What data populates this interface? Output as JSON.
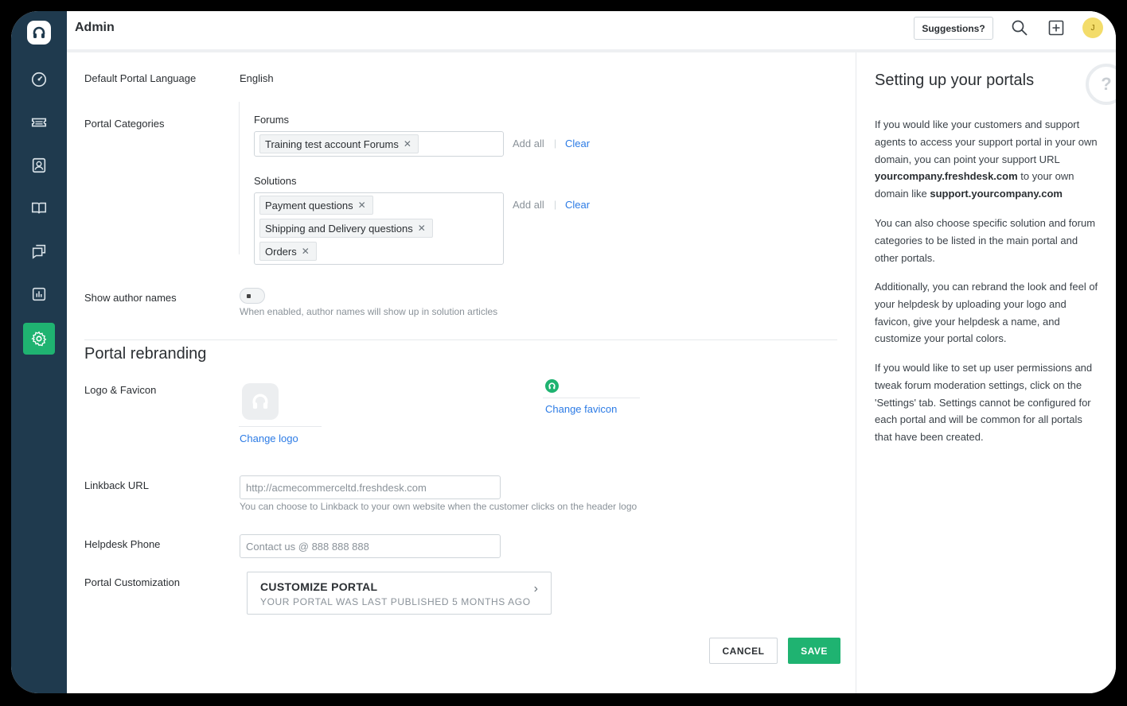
{
  "topbar": {
    "title": "Admin",
    "suggestions_label": "Suggestions?",
    "avatar_initial": "J",
    "icons": [
      "search-icon",
      "add-new-icon"
    ]
  },
  "sidebar": {
    "items": [
      {
        "name": "dashboard",
        "icon": "gauge-icon"
      },
      {
        "name": "tickets",
        "icon": "ticket-icon"
      },
      {
        "name": "contacts",
        "icon": "contact-icon"
      },
      {
        "name": "solutions",
        "icon": "book-icon"
      },
      {
        "name": "forums",
        "icon": "discussion-icon"
      },
      {
        "name": "reports",
        "icon": "chart-icon"
      },
      {
        "name": "admin",
        "icon": "gear-icon",
        "active": true
      }
    ]
  },
  "form": {
    "default_language": {
      "label": "Default Portal Language",
      "value": "English"
    },
    "portal_categories": {
      "label": "Portal Categories",
      "forums": {
        "label": "Forums",
        "tags": [
          "Training test account Forums"
        ]
      },
      "solutions": {
        "label": "Solutions",
        "tags": [
          "Payment questions",
          "Shipping and Delivery questions",
          "Orders"
        ]
      },
      "add_all": "Add all",
      "clear": "Clear"
    },
    "show_author": {
      "label": "Show author names",
      "enabled": false,
      "help": "When enabled, author names will show up in solution articles"
    },
    "rebranding": {
      "title": "Portal rebranding",
      "logo_label": "Logo & Favicon",
      "change_logo": "Change logo",
      "change_favicon": "Change favicon"
    },
    "linkback": {
      "label": "Linkback URL",
      "placeholder": "http://acmecommerceltd.freshdesk.com",
      "help": "You can choose to Linkback to your own website when the customer clicks on the header logo"
    },
    "phone": {
      "label": "Helpdesk Phone",
      "placeholder": "Contact us @ 888 888 888"
    },
    "customization": {
      "label": "Portal Customization",
      "card_title": "CUSTOMIZE PORTAL",
      "card_sub": "YOUR PORTAL WAS LAST PUBLISHED 5 MONTHS AGO"
    },
    "actions": {
      "cancel": "CANCEL",
      "save": "SAVE"
    }
  },
  "help_panel": {
    "title": "Setting up your portals",
    "p1_a": "If you would like your customers and support agents to access your support portal in your own domain, you can point your support URL ",
    "p1_b": "yourcompany.freshdesk.com",
    "p1_c": " to your own domain like ",
    "p1_d": "support.yourcompany.com",
    "p2": "You can also choose specific solution and forum categories to be listed in the main portal and other portals.",
    "p3": "Additionally, you can rebrand the look and feel of your helpdesk by uploading your logo and favicon, give your helpdesk a name, and customize your portal colors.",
    "p4": "If you would like to set up user permissions and tweak forum moderation settings, click on the 'Settings' tab. Settings cannot be configured for each portal and will be common for all portals that have been created."
  },
  "colors": {
    "sidebar": "#1f3a4e",
    "accent": "#1fb371",
    "link": "#2c7be5"
  }
}
